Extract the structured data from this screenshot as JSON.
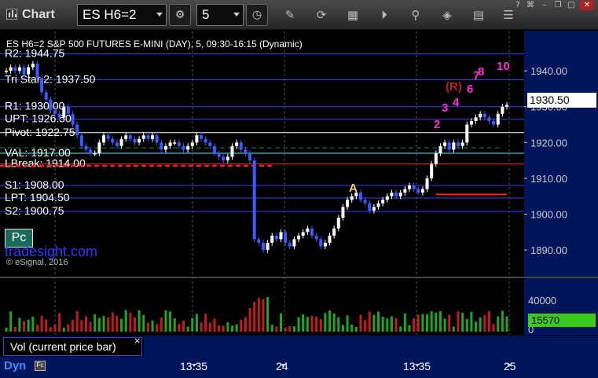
{
  "window": {
    "title": "Chart"
  },
  "toolbar": {
    "symbol": "ES H6=2",
    "interval": "5",
    "icons": [
      "cycle-icon",
      "clock-icon",
      "pencil-icon",
      "refresh-icon",
      "calc-icon",
      "play-icon",
      "tag-icon",
      "settings-icon"
    ]
  },
  "chart_header": "ES H6=2 S&P 500 FUTURES E-MINI (DAY), 5, 09:30-16:15 (Dynamic)",
  "levels": [
    {
      "label": "R2: 1944.75",
      "value": 1944.75,
      "color": "#3b3bff",
      "style": "solid"
    },
    {
      "label": "Tri Star 2: 1937.50",
      "value": 1937.5,
      "color": "#3b3bff",
      "style": "solid"
    },
    {
      "label": "R1: 1930.00",
      "value": 1930.0,
      "color": "#3b3bff",
      "style": "solid"
    },
    {
      "label": "UPT: 1926.50",
      "value": 1926.5,
      "color": "#3b3bff",
      "style": "solid"
    },
    {
      "label": "Pivot: 1922.75",
      "value": 1922.75,
      "color": "#ffffff",
      "style": "solid"
    },
    {
      "label": "VAL: 1917.00",
      "value": 1917.0,
      "color": "#6fe0ff",
      "style": "solid"
    },
    {
      "label": "LBreak: 1914.00",
      "value": 1914.0,
      "color": "#ff2020",
      "style": "solid"
    },
    {
      "label": "S1: 1908.00",
      "value": 1908.0,
      "color": "#3b3bff",
      "style": "solid"
    },
    {
      "label": "LPT: 1904.50",
      "value": 1904.5,
      "color": "#3b3bff",
      "style": "solid"
    },
    {
      "label": "S2: 1900.75",
      "value": 1900.75,
      "color": "#3b3bff",
      "style": "solid"
    }
  ],
  "price_tag": "1930.50",
  "volume_tag": "15570",
  "volume_label": "Vol (current price bar)",
  "volume_axis": [
    "40000",
    "0"
  ],
  "close_symbol": "×",
  "pc_label": "Pc",
  "brand": "tradesight.com",
  "copyright": "© eSignal, 2016",
  "dyn_label": "Dyn",
  "x_ticks": [
    "13:35",
    "24",
    "13:35",
    "25"
  ],
  "annotations": [
    "A",
    "2",
    "3",
    "4",
    "(R)",
    "6",
    "7",
    "8",
    "10"
  ],
  "chart_data": {
    "type": "candlestick",
    "title": "ES H6=2 S&P 500 FUTURES E-MINI (DAY), 5, 09:30-16:15 (Dynamic)",
    "y_ticks": [
      1940.0,
      1930.0,
      1920.0,
      1910.0,
      1900.0,
      1890.0
    ],
    "ylim": [
      1883,
      1951
    ],
    "x_ticks": [
      "13:35",
      "24",
      "13:35",
      "25"
    ],
    "last_price": 1930.5,
    "close": [
      1940,
      1941,
      1940,
      1941,
      1939,
      1941,
      1942,
      1938,
      1934,
      1932,
      1929,
      1928,
      1927,
      1930,
      1928,
      1925,
      1922,
      1919,
      1918,
      1917,
      1917,
      1920,
      1922,
      1921,
      1920,
      1919,
      1921,
      1922,
      1921,
      1920,
      1921,
      1922,
      1921,
      1922,
      1920,
      1918,
      1919,
      1920,
      1920,
      1919,
      1918,
      1919,
      1920,
      1922,
      1921,
      1920,
      1919,
      1917,
      1916,
      1915,
      1916,
      1919,
      1920,
      1918,
      1917,
      1915,
      1893,
      1892,
      1890,
      1892,
      1894,
      1893,
      1895,
      1892,
      1891,
      1893,
      1894,
      1895,
      1896,
      1894,
      1893,
      1891,
      1892,
      1894,
      1896,
      1899,
      1902,
      1904,
      1905,
      1906,
      1904,
      1903,
      1901,
      1902,
      1903,
      1904,
      1905,
      1906,
      1905,
      1906,
      1907,
      1908,
      1907,
      1906,
      1907,
      1910,
      1914,
      1917,
      1919,
      1920,
      1918,
      1920,
      1919,
      1920,
      1925,
      1926,
      1927,
      1928,
      1927,
      1926,
      1925,
      1928,
      1930,
      1930.5
    ],
    "volume_max": 40000,
    "volume_last": 15570
  }
}
